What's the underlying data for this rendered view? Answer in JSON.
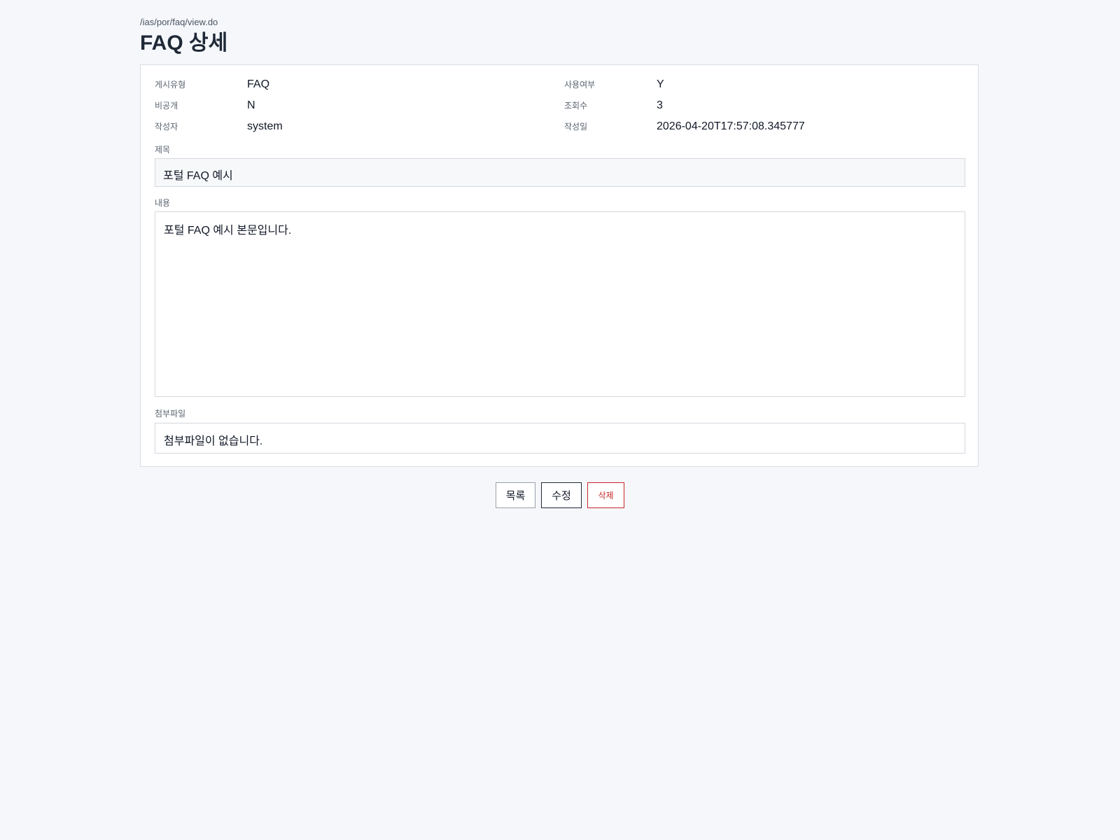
{
  "header": {
    "path": "/ias/por/faq/view.do",
    "title": "FAQ 상세"
  },
  "meta": {
    "board_type_label": "게시유형",
    "board_type_value": "FAQ",
    "use_yn_label": "사용여부",
    "use_yn_value": "Y",
    "private_label": "비공개",
    "private_value": "N",
    "views_label": "조회수",
    "views_value": "3",
    "author_label": "작성자",
    "author_value": "system",
    "created_label": "작성일",
    "created_value": "2026-04-20T17:57:08.345777"
  },
  "subject": {
    "label": "제목",
    "value": "포털 FAQ 예시"
  },
  "content": {
    "label": "내용",
    "value": "포털 FAQ 예시 본문입니다."
  },
  "attachment": {
    "label": "첨부파일",
    "value": "첨부파일이 없습니다."
  },
  "actions": {
    "list_label": "목록",
    "edit_label": "수정",
    "delete_label": "삭제"
  },
  "colors": {
    "background": "#f5f7fa",
    "delete_accent": "#c62828"
  }
}
